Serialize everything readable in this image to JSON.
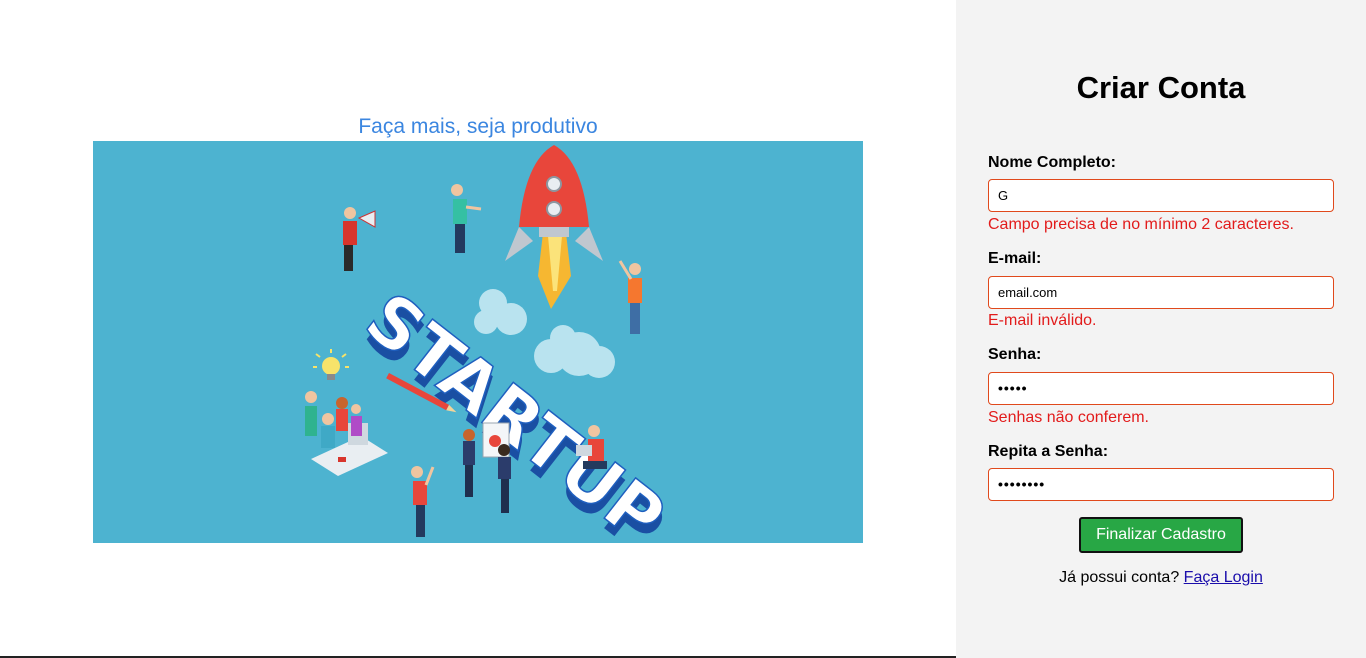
{
  "hero": {
    "tagline": "Faça mais, seja produtivo",
    "illustration_word": "STARTUP",
    "background_color": "#4db3d0"
  },
  "form": {
    "title": "Criar Conta",
    "fields": [
      {
        "label": "Nome Completo:",
        "value": "G",
        "error": "Campo precisa de no mínimo 2 caracteres."
      },
      {
        "label": "E-mail:",
        "value": "email.com",
        "error": "E-mail inválido."
      },
      {
        "label": "Senha:",
        "value": "•••••",
        "error": "Senhas não conferem."
      },
      {
        "label": "Repita a Senha:",
        "value": "••••••••",
        "error": ""
      }
    ],
    "submit_label": "Finalizar Cadastro",
    "login_prompt": "Já possui conta?",
    "login_link": "Faça Login"
  },
  "colors": {
    "error": "#e21b1b",
    "input_border": "#e0491c",
    "submit_bg": "#28a745",
    "tagline": "#3b86e0",
    "panel_bg": "#f3f3f3"
  }
}
